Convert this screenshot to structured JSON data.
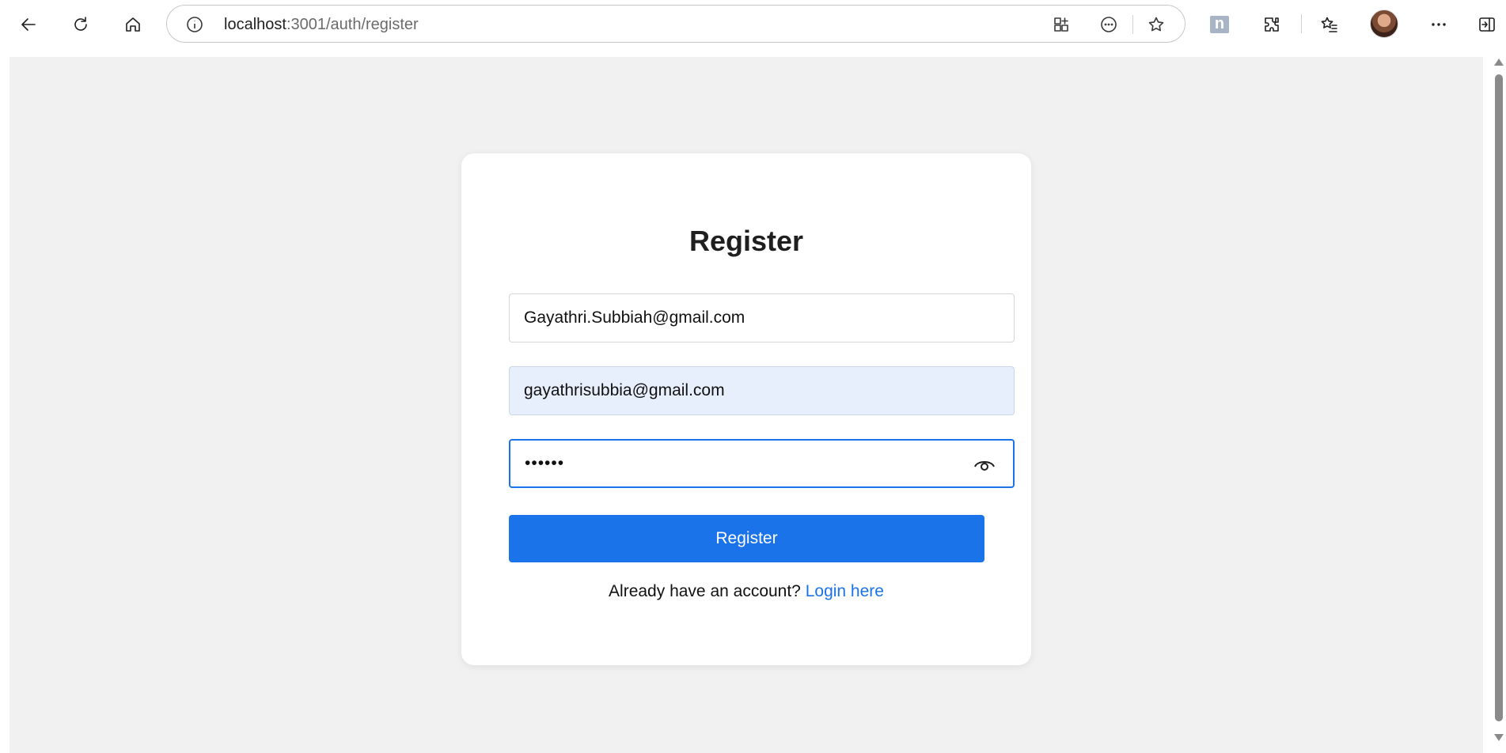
{
  "browser": {
    "url_host": "localhost",
    "url_rest": ":3001/auth/register",
    "badge_letter": "n"
  },
  "form": {
    "title": "Register",
    "name_value": "Gayathri.Subbiah@gmail.com",
    "email_value": "gayathrisubbia@gmail.com",
    "password_value": "••••••",
    "submit_label": "Register",
    "footer_text": "Already have an account?",
    "login_link": "Login here"
  },
  "colors": {
    "accent": "#1a73e8",
    "page_bg": "#f1f1f1",
    "autofill_bg": "#e8effc"
  }
}
